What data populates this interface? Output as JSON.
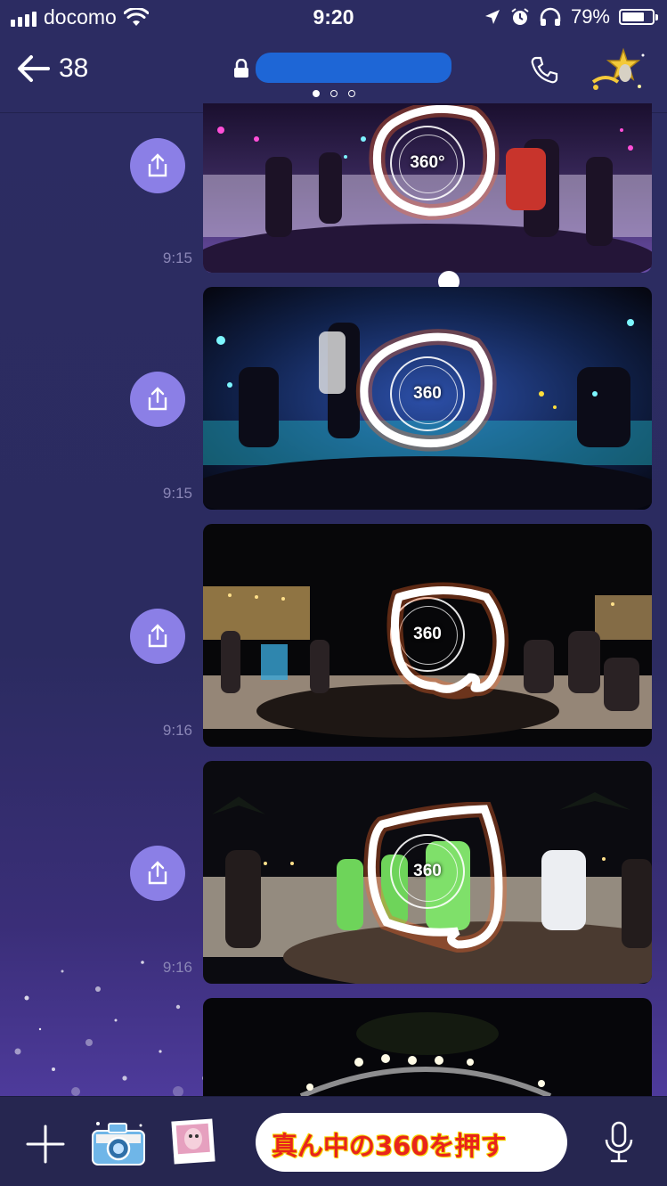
{
  "status": {
    "carrier": "docomo",
    "time": "9:20",
    "battery_percent": "79%",
    "battery_level": 0.79
  },
  "header": {
    "back_count": "38",
    "page_indicator_count": 3,
    "active_page": 0
  },
  "messages": [
    {
      "time": "9:15",
      "badge": "360°"
    },
    {
      "time": "9:15",
      "badge": "360"
    },
    {
      "time": "9:16",
      "badge": "360"
    },
    {
      "time": "9:16",
      "badge": "360"
    },
    {
      "time": "",
      "badge": ""
    }
  ],
  "composer": {
    "input_value": "真ん中の360を押す"
  },
  "icons": [
    "back-arrow-icon",
    "lock-icon",
    "phone-icon",
    "fairy-avatar-icon",
    "share-icon",
    "plus-icon",
    "camera-icon",
    "photo-icon",
    "mic-icon"
  ],
  "colors": {
    "background": "#2b2b60",
    "share_button": "#8b7fe6",
    "redaction": "#1e66d6",
    "annotation_text": "#e8241c"
  }
}
